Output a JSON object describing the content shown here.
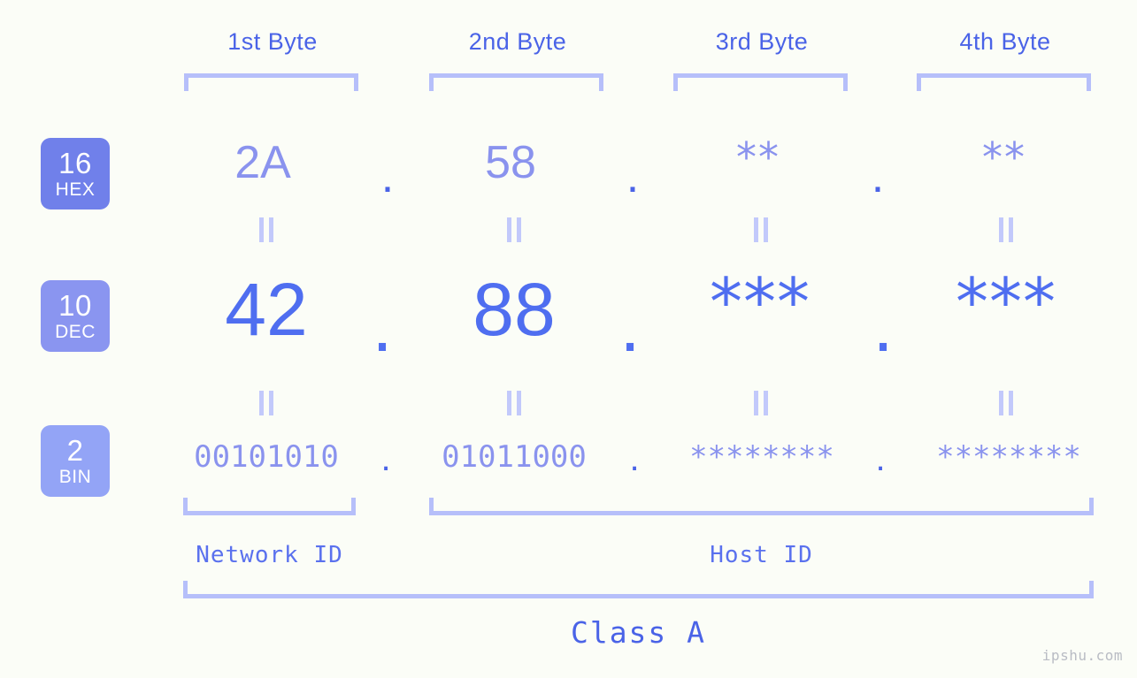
{
  "page": {
    "background_color": "#fbfdf7",
    "accent_color": "#4f6ef0",
    "muted_accent_color": "#8a93ee",
    "bracket_color": "#b6bffa",
    "watermark": "ipshu.com"
  },
  "byte_headers": [
    {
      "label": "1st Byte"
    },
    {
      "label": "2nd Byte"
    },
    {
      "label": "3rd Byte"
    },
    {
      "label": "4th Byte"
    }
  ],
  "bases": [
    {
      "number": "16",
      "abbr": "HEX",
      "badge_color": "#7080ea"
    },
    {
      "number": "10",
      "abbr": "DEC",
      "badge_color": "#8a95f0"
    },
    {
      "number": "2",
      "abbr": "BIN",
      "badge_color": "#93a4f6"
    }
  ],
  "rows": {
    "hex": {
      "values": [
        "2A",
        "58",
        "**",
        "**"
      ],
      "separators": [
        ".",
        ".",
        "."
      ]
    },
    "dec": {
      "values": [
        "42",
        "88",
        "***",
        "***"
      ],
      "separators": [
        ".",
        ".",
        "."
      ]
    },
    "bin": {
      "values": [
        "00101010",
        "01011000",
        "********",
        "********"
      ],
      "separators": [
        ".",
        ".",
        "."
      ]
    }
  },
  "equals_symbol": "||",
  "segments": {
    "network_id": "Network ID",
    "host_id": "Host ID",
    "class": "Class A"
  }
}
